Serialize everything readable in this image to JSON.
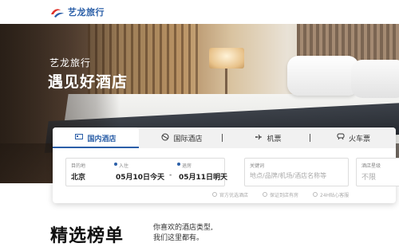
{
  "brand": {
    "name": "艺龙旅行",
    "logo_colors": [
      "#e0322a",
      "#2b5fa8"
    ]
  },
  "hero": {
    "brand_small": "艺龙旅行",
    "slogan": "遇见好酒店"
  },
  "tabs": [
    {
      "label": "国内酒店",
      "icon": "hotel-icon",
      "active": true
    },
    {
      "label": "国际酒店",
      "icon": "globe-icon",
      "active": false
    },
    {
      "label": "机票",
      "icon": "plane-icon",
      "active": false
    },
    {
      "label": "火车票",
      "icon": "train-icon",
      "active": false
    }
  ],
  "search": {
    "destination_label": "目的地",
    "destination_value": "北京",
    "checkin_label": "入住",
    "checkin_value": "05月10日今天",
    "date_separator": "-",
    "checkout_label": "退房",
    "checkout_value": "05月11日明天",
    "keyword_label": "关键词",
    "keyword_placeholder": "地点/品牌/机场/酒店名称等",
    "star_label": "酒店星级",
    "star_value": "不限"
  },
  "badges": [
    "官方优选酒店",
    "保证到店有房",
    "24H贴心客服"
  ],
  "section": {
    "title": "精选榜单",
    "desc_line1": "你喜欢的酒店类型,",
    "desc_line2": "我们这里都有。"
  },
  "colors": {
    "accent": "#2b5fa8",
    "brand_red": "#e0322a"
  }
}
